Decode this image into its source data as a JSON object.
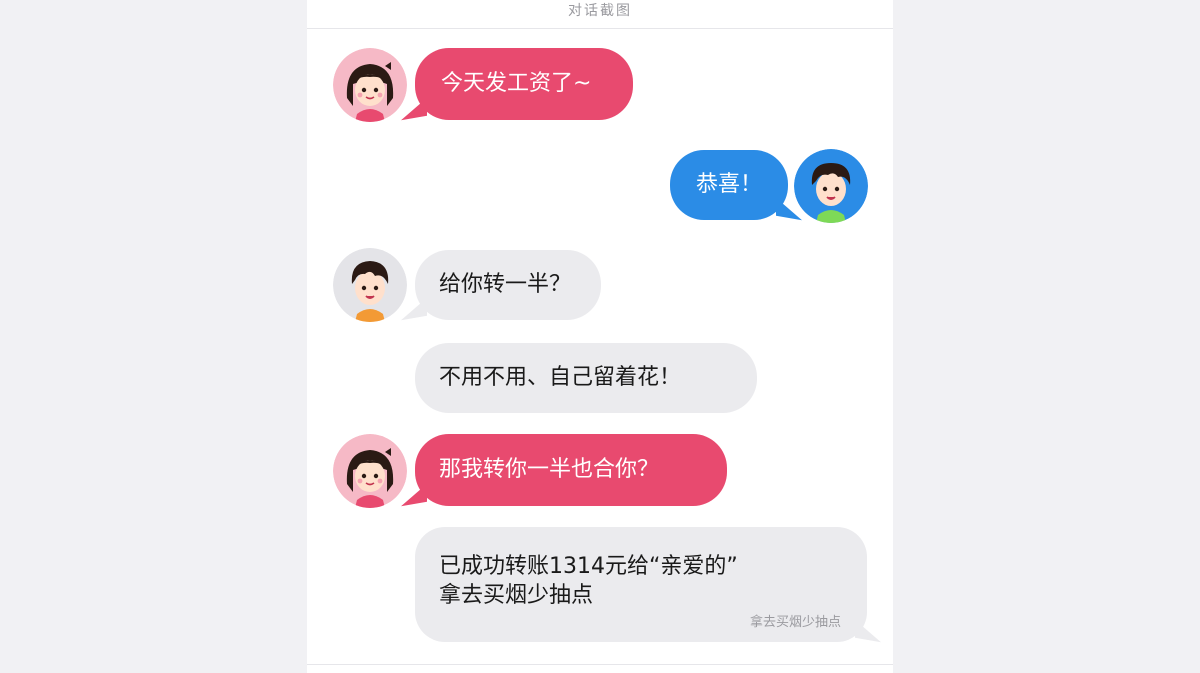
{
  "header": {
    "title": "对话截图"
  },
  "messages": [
    {
      "sender": "girl",
      "side": "left",
      "style": "pink",
      "text": "今天发工资了~"
    },
    {
      "sender": "boy",
      "side": "right",
      "style": "blue",
      "text": "恭喜！"
    },
    {
      "sender": "boy2",
      "side": "left",
      "style": "gray",
      "text": "给你转一半？"
    },
    {
      "sender": "boy2",
      "side": "left",
      "style": "gray",
      "text": "不用不用、自己留着花！"
    },
    {
      "sender": "girl",
      "side": "left",
      "style": "pink",
      "text": "那我转你一半也合你？"
    },
    {
      "sender": "boy2",
      "side": "left",
      "style": "gray",
      "line1": "已成功转账1314元给“亲爱的”",
      "line2": "拿去买烟少抽点",
      "note": "拿去买烟少抽点"
    }
  ],
  "colors": {
    "pink": "#e84a6f",
    "blue": "#2b8ce6",
    "gray": "#ebebee",
    "background": "#f1f1f4"
  }
}
